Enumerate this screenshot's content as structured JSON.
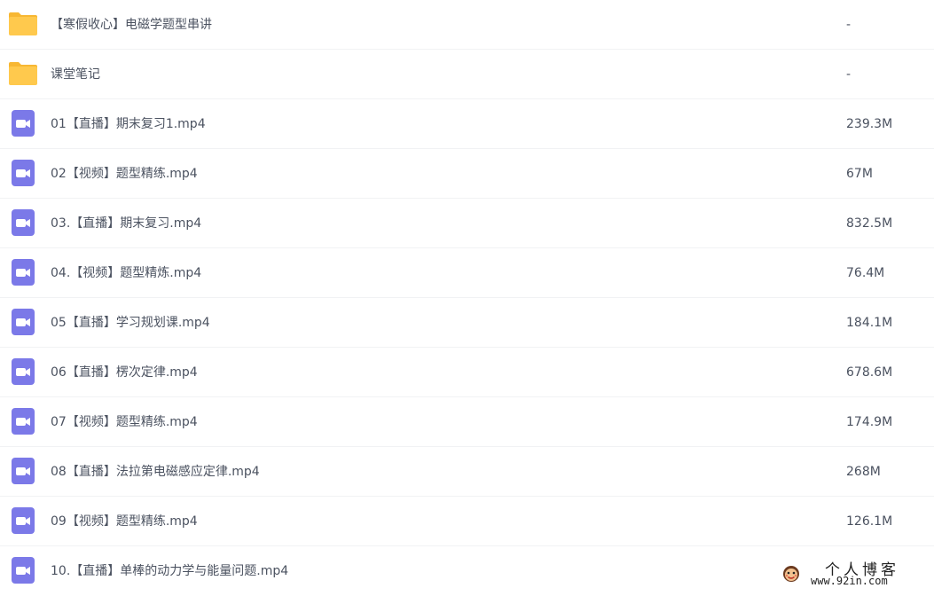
{
  "files": [
    {
      "icon": "folder-icon",
      "name": "【寒假收心】电磁学题型串讲",
      "size": "-"
    },
    {
      "icon": "folder-icon",
      "name": "课堂笔记",
      "size": "-"
    },
    {
      "icon": "video-file-icon",
      "name": "01【直播】期末复习1.mp4",
      "size": "239.3M"
    },
    {
      "icon": "video-file-icon",
      "name": "02【视频】题型精练.mp4",
      "size": "67M"
    },
    {
      "icon": "video-file-icon",
      "name": "03.【直播】期末复习.mp4",
      "size": "832.5M"
    },
    {
      "icon": "video-file-icon",
      "name": "04.【视频】题型精炼.mp4",
      "size": "76.4M"
    },
    {
      "icon": "video-file-icon",
      "name": "05【直播】学习规划课.mp4",
      "size": "184.1M"
    },
    {
      "icon": "video-file-icon",
      "name": "06【直播】楞次定律.mp4",
      "size": "678.6M"
    },
    {
      "icon": "video-file-icon",
      "name": "07【视频】题型精练.mp4",
      "size": "174.9M"
    },
    {
      "icon": "video-file-icon",
      "name": "08【直播】法拉第电磁感应定律.mp4",
      "size": "268M"
    },
    {
      "icon": "video-file-icon",
      "name": "09【视频】题型精练.mp4",
      "size": "126.1M"
    },
    {
      "icon": "video-file-icon",
      "name": "10.【直播】单棒的动力学与能量问题.mp4",
      "size": ""
    }
  ],
  "colors": {
    "folder": "#ffc94d",
    "folder_tab": "#f7b733",
    "video": "#7b79e8",
    "text": "#4b5260",
    "divider": "#f1f2f4"
  },
  "watermark": {
    "title": "个人博客",
    "url": "www.92in.com"
  }
}
